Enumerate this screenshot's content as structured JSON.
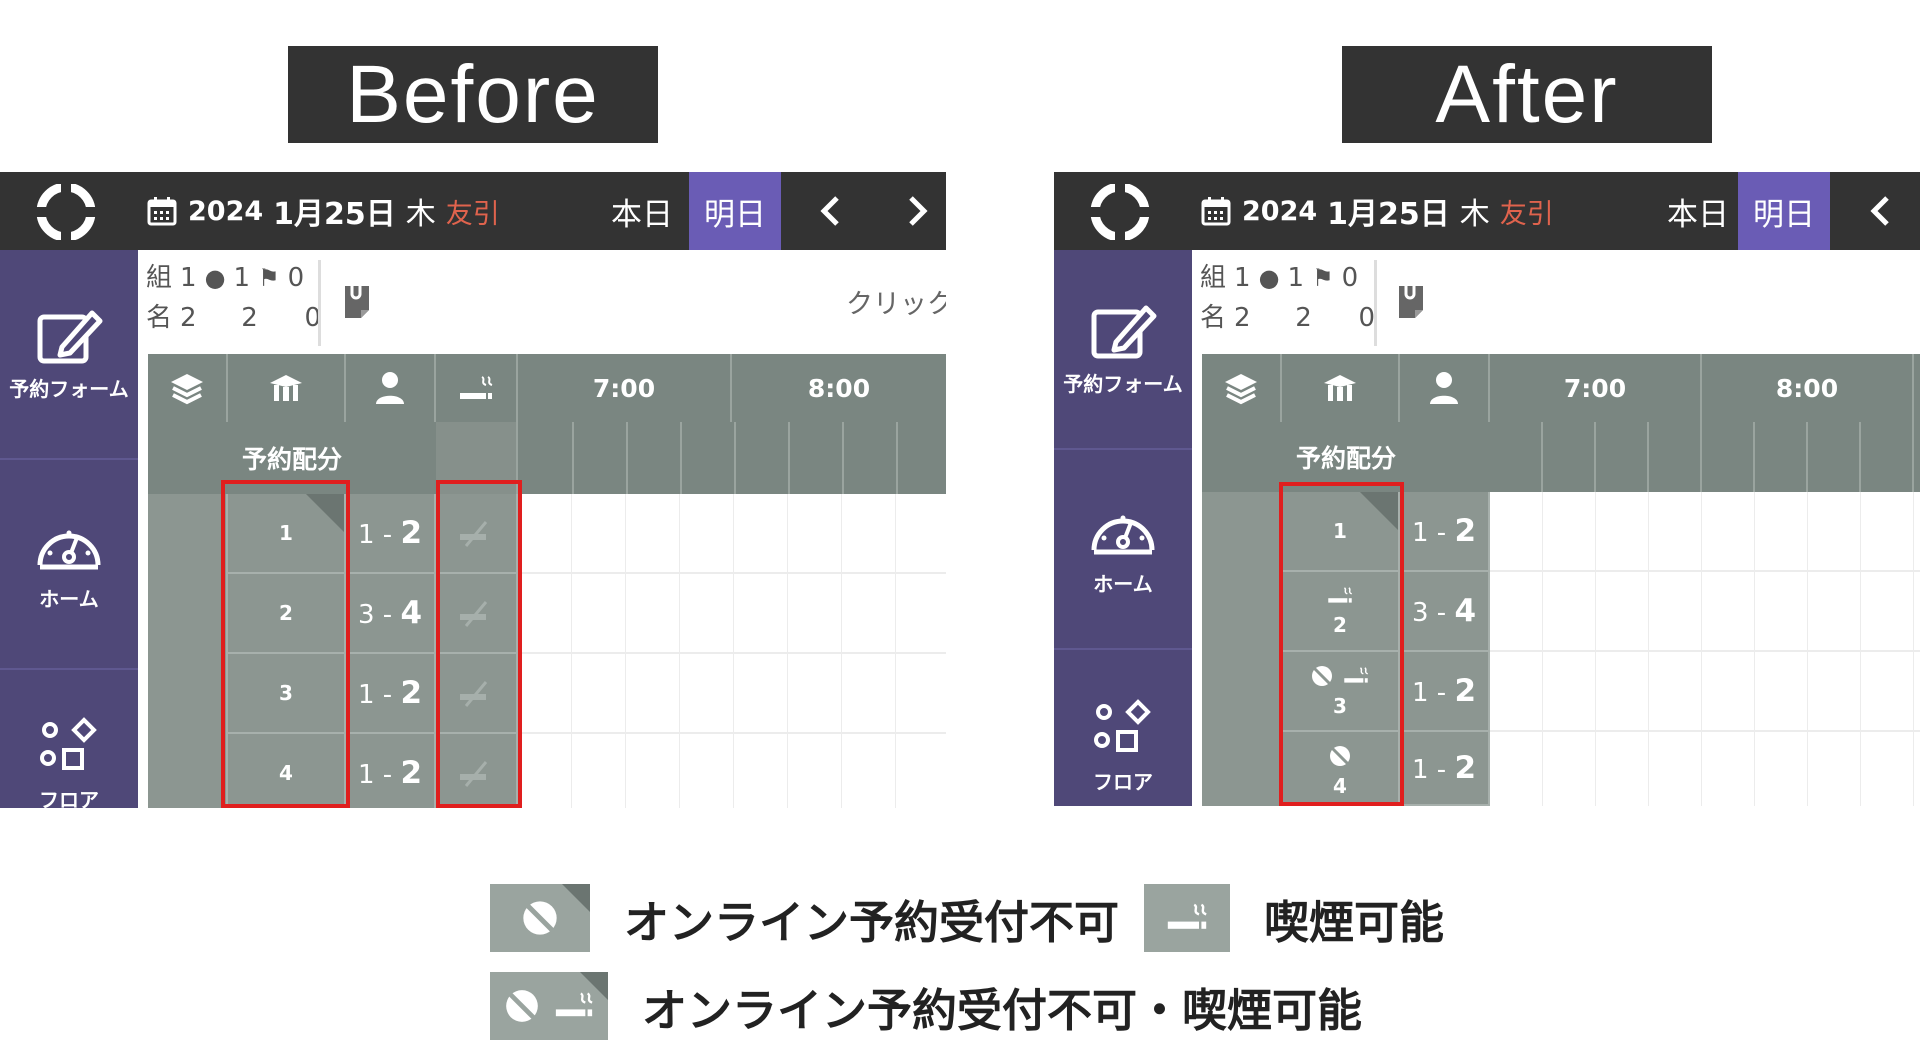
{
  "labels": {
    "before": "Before",
    "after": "After"
  },
  "topbar": {
    "year": "2024",
    "date": "1月25日",
    "weekday": "木",
    "rokuyo": "友引",
    "today": "本日",
    "tomorrow": "明日"
  },
  "sidebar": {
    "reservation_form": "予約フォーム",
    "home": "ホーム",
    "floor": "フロア"
  },
  "info": {
    "groups_label": "組",
    "groups_total": "1",
    "groups_online": "1",
    "groups_walkin": "0",
    "people_label": "名",
    "people_total": "2",
    "people_online": "2",
    "people_walkin": "0"
  },
  "click_hint": "クリック",
  "grid": {
    "times": [
      "7:00",
      "8:00"
    ],
    "allocation_label": "予約配分",
    "rows": [
      {
        "num": "1",
        "min": "1",
        "max": "2"
      },
      {
        "num": "2",
        "min": "3",
        "max": "4"
      },
      {
        "num": "3",
        "min": "1",
        "max": "2"
      },
      {
        "num": "4",
        "min": "1",
        "max": "2"
      }
    ]
  },
  "legend": {
    "online_disabled": "オンライン予約受付不可",
    "smoking": "喫煙可能",
    "both": "オンライン予約受付不可・喫煙可能"
  },
  "colors": {
    "header": "#333333",
    "sidebar": "#4f4878",
    "accent": "#6a5cb5",
    "grid": "#8c9691",
    "highlight": "#e01e1e",
    "rokuyo": "#e0634d"
  }
}
